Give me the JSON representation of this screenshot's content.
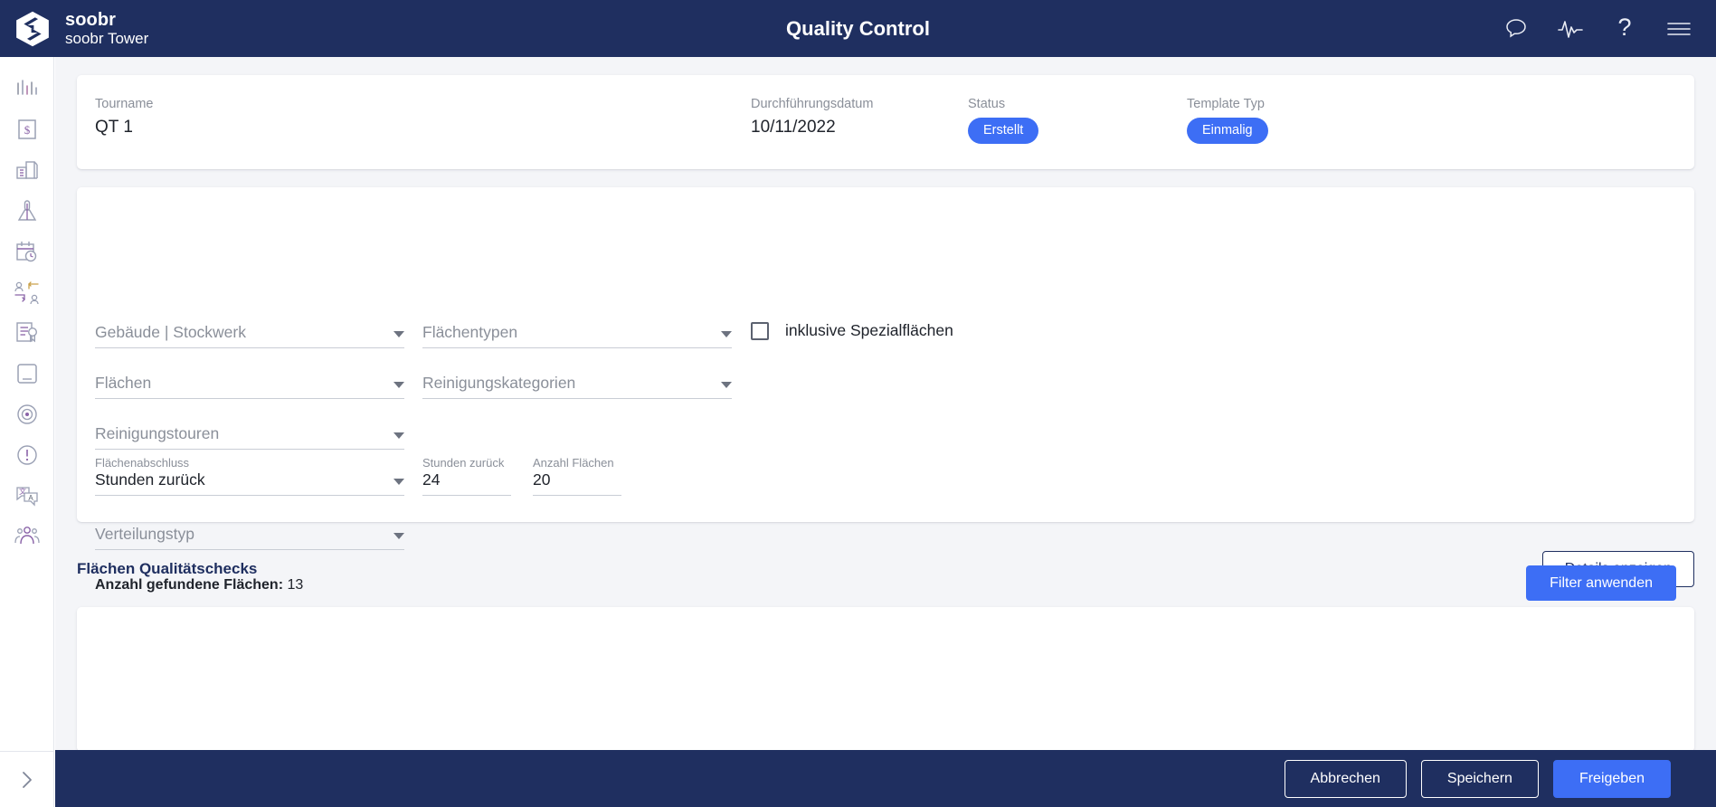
{
  "topbar": {
    "brand_name": "soobr",
    "brand_sub": "soobr Tower",
    "title": "Quality Control",
    "icons": [
      {
        "name": "chat-icon",
        "label": "Chat"
      },
      {
        "name": "activity-icon",
        "label": "Activity"
      },
      {
        "name": "help-icon",
        "label": "?"
      },
      {
        "name": "menu-icon",
        "label": "Menu"
      }
    ]
  },
  "sidebar": {
    "items": [
      {
        "name": "sidebar-item-statistics",
        "icon": "bar-chart-icon"
      },
      {
        "name": "sidebar-item-costs",
        "icon": "dollar-document-icon"
      },
      {
        "name": "sidebar-item-buildings",
        "icon": "building-icon"
      },
      {
        "name": "sidebar-item-cleaning",
        "icon": "broom-icon"
      },
      {
        "name": "sidebar-item-schedule",
        "icon": "calendar-clock-icon"
      },
      {
        "name": "sidebar-item-assignments",
        "icon": "user-transfer-icon"
      },
      {
        "name": "sidebar-item-quality-control",
        "icon": "document-badge-icon"
      },
      {
        "name": "sidebar-item-tablet",
        "icon": "tablet-icon"
      },
      {
        "name": "sidebar-item-tracking",
        "icon": "target-icon"
      },
      {
        "name": "sidebar-item-alerts",
        "icon": "alert-circle-icon"
      },
      {
        "name": "sidebar-item-translations",
        "icon": "translate-icon"
      },
      {
        "name": "sidebar-item-teams",
        "icon": "users-icon"
      }
    ],
    "expand": {
      "name": "sidebar-expand-button",
      "icon": "chevron-right-icon"
    }
  },
  "summary": {
    "tourname": {
      "label": "Tourname",
      "value": "QT 1"
    },
    "date": {
      "label": "Durchführungsdatum",
      "value": "10/11/2022"
    },
    "status": {
      "label": "Status",
      "value": "Erstellt"
    },
    "template": {
      "label": "Template Typ",
      "value": "Einmalig"
    }
  },
  "filters": {
    "gebaeude": {
      "label": "Gebäude | Stockwerk",
      "value": "",
      "placeholder": "Gebäude | Stockwerk"
    },
    "flaechentypen": {
      "label": "Flächentypen",
      "value": "",
      "placeholder": "Flächentypen"
    },
    "flaechen": {
      "label": "Flächen",
      "value": "",
      "placeholder": "Flächen"
    },
    "reinigungskategorien": {
      "label": "Reinigungskategorien",
      "value": "",
      "placeholder": "Reinigungskategorien"
    },
    "reinigungstouren": {
      "label": "Reinigungstouren",
      "value": "",
      "placeholder": "Reinigungstouren"
    },
    "flaechenabschluss": {
      "label": "Flächenabschluss",
      "value": "Stunden zurück"
    },
    "stunden_zurueck": {
      "label": "Stunden zurück",
      "value": "24"
    },
    "anzahl_flaechen": {
      "label": "Anzahl Flächen",
      "value": "20"
    },
    "verteilungstyp": {
      "label": "Verteilungstyp",
      "value": "",
      "placeholder": "Verteilungstyp"
    },
    "spezialflaechen": {
      "label": "inklusive Spezialflächen",
      "checked": false
    },
    "found": {
      "label": "Anzahl gefundene Flächen:",
      "count": "13"
    },
    "apply_button": "Filter anwenden"
  },
  "section": {
    "title": "Flächen Qualitätschecks",
    "details_button": "Details anzeigen"
  },
  "footer": {
    "cancel": "Abbrechen",
    "save": "Speichern",
    "release": "Freigeben"
  },
  "colors": {
    "navy": "#1f2f60",
    "accent": "#3d6ef5",
    "page_bg": "#f4f5f8",
    "card_bg": "#ffffff",
    "muted_text": "#8a8f99"
  }
}
